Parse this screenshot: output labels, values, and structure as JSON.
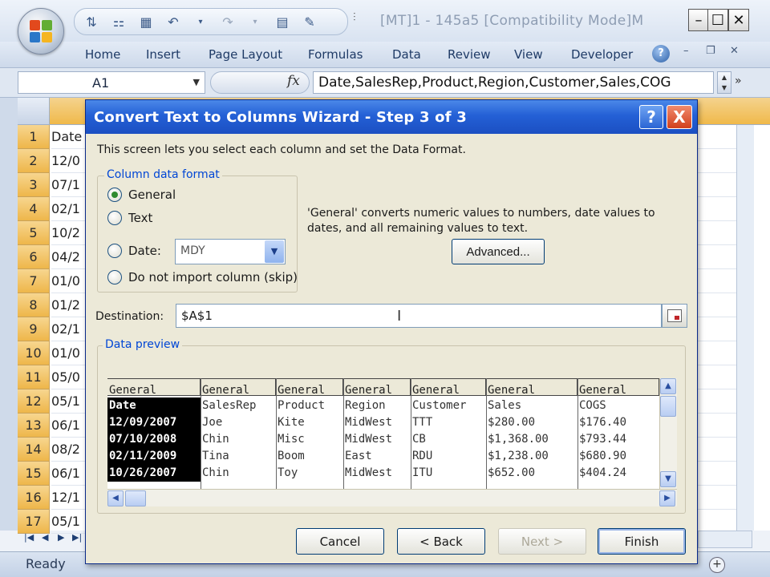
{
  "window": {
    "title": "[MT]1 - 145a5  [Compatibility Mode]M"
  },
  "ribbon": {
    "tabs": [
      "Home",
      "Insert",
      "Page Layout",
      "Formulas",
      "Data",
      "Review",
      "View",
      "Developer"
    ]
  },
  "formula_bar": {
    "name_box": "A1",
    "fx": "fx",
    "formula": "Date,SalesRep,Product,Region,Customer,Sales,COG"
  },
  "sheet": {
    "rows": [
      "1",
      "2",
      "3",
      "4",
      "5",
      "6",
      "7",
      "8",
      "9",
      "10",
      "11",
      "12",
      "13",
      "14",
      "15",
      "16",
      "17"
    ],
    "colA": [
      "Date",
      "12/0",
      "07/1",
      "02/1",
      "10/2",
      "04/2",
      "01/0",
      "01/2",
      "02/1",
      "01/0",
      "05/0",
      "05/1",
      "06/1",
      "08/2",
      "06/1",
      "12/1",
      "05/1"
    ]
  },
  "status": {
    "text": "Ready"
  },
  "dialog": {
    "title": "Convert Text to Columns Wizard - Step 3 of 3",
    "help": "?",
    "close": "X",
    "intro": "This screen lets you select each column and set the Data Format.",
    "format_group": "Column data format",
    "radio_general": "General",
    "radio_text": "Text",
    "radio_date": "Date:",
    "radio_skip": "Do not import column (skip)",
    "date_value": "MDY",
    "description": "'General' converts numeric values to numbers, date values to dates, and all remaining values to text.",
    "advanced": "Advanced...",
    "destination_label": "Destination:",
    "destination_value": "$A$1",
    "preview_label": "Data preview",
    "preview": {
      "columns": [
        {
          "header": "General",
          "cells": [
            "Date",
            "12/09/2007",
            "07/10/2008",
            "02/11/2009",
            "10/26/2007"
          ]
        },
        {
          "header": "General",
          "cells": [
            "SalesRep",
            "Joe",
            "Chin",
            "Tina",
            "Chin"
          ]
        },
        {
          "header": "General",
          "cells": [
            "Product",
            "Kite",
            "Misc",
            "Boom",
            "Toy"
          ]
        },
        {
          "header": "General",
          "cells": [
            "Region",
            "MidWest",
            "MidWest",
            "East",
            "MidWest"
          ]
        },
        {
          "header": "General",
          "cells": [
            "Customer",
            "TTT",
            "CB",
            "RDU",
            "ITU"
          ]
        },
        {
          "header": "General",
          "cells": [
            "Sales",
            "$280.00",
            "$1,368.00",
            "$1,238.00",
            "$652.00"
          ]
        },
        {
          "header": "General",
          "cells": [
            "COGS",
            "$176.40",
            "$793.44",
            "$680.90",
            "$404.24"
          ]
        }
      ]
    },
    "buttons": {
      "cancel": "Cancel",
      "back": "< Back",
      "next": "Next >",
      "finish": "Finish"
    }
  },
  "colors": {
    "title_blue": "#2460d6",
    "row_header": "#f0b94a",
    "legend_blue": "#0046d5"
  }
}
